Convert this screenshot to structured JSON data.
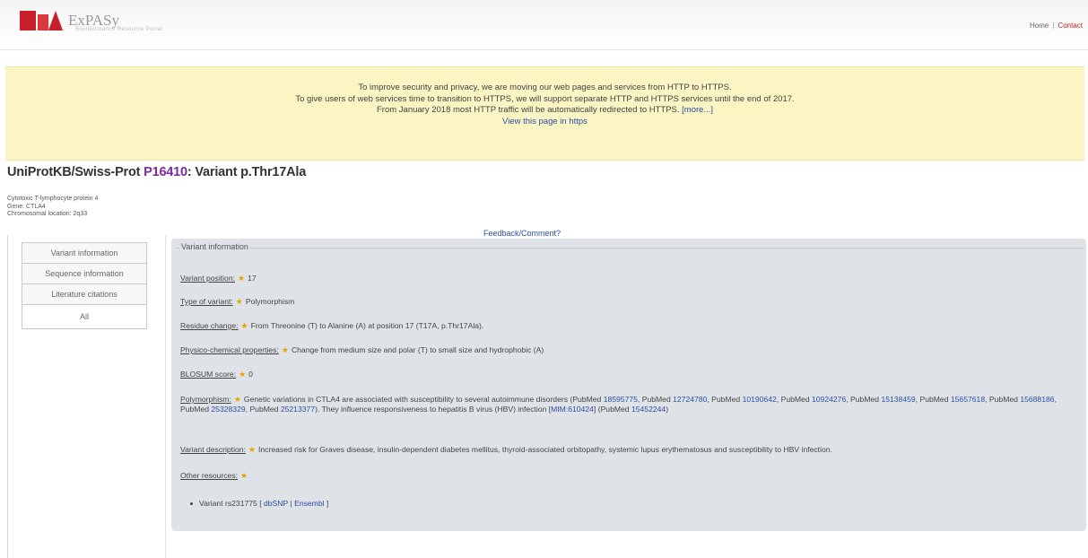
{
  "header": {
    "logo_text": "ExPASy",
    "logo_sub": "Bioinformatics Resource Portal",
    "links": {
      "home": "Home",
      "separator": "|",
      "contact": "Contact"
    }
  },
  "notice": {
    "line1": "To improve security and privacy, we are moving our web pages and services from HTTP to HTTPS.",
    "line2": "To give users of web services time to transition to HTTPS, we will support separate HTTP and HTTPS services until the end of 2017.",
    "line3_text": "From January 2018 most HTTP traffic will be automatically redirected to HTTPS.",
    "more_link": "[more...]",
    "line4": "View this page in https"
  },
  "page": {
    "title_prefix": "UniProtKB/Swiss-Prot",
    "accession": "P16410",
    "title_suffix": ": Variant p.Thr17Ala",
    "protein_name": "Cytotoxic T-lymphocyte protein 4",
    "gene": "Gene: CTLA4",
    "chromosomal_location": "Chromosomal location: 2q33",
    "feedback": "Feedback/Comment?"
  },
  "sidenav": {
    "items": [
      "Variant information",
      "Sequence information",
      "Literature citations",
      "All"
    ]
  },
  "variant_info": {
    "legend": "Variant information",
    "position_label": "Variant position:",
    "position_value": "17",
    "type_label": "Type of variant:",
    "type_value": "Polymorphism",
    "residue_label": "Residue change:",
    "residue_value": "From Threonine (T) to Alanine (A) at position 17 (T17A, p.Thr17Ala).",
    "physico_label": "Physico-chemical properties:",
    "physico_value": "Change from medium size and polar (T) to small size and hydrophobic (A)",
    "blosum_label": "BLOSUM score:",
    "blosum_value": "0",
    "poly_label": "Polymorphism:",
    "poly_text_1": "Genetic variations in CTLA4 are associated with susceptibility to several autoimmune disorders (PubMed",
    "pubmed_1": "18595775",
    "pubmed_2": "12724780",
    "pubmed_3": "10190642",
    "pubmed_4": "10924276",
    "pubmed_5": "15138459",
    "pubmed_6": "15657618",
    "pubmed_7": "15688186",
    "pubmed_8": "25328329",
    "pubmed_9": "25213377",
    "poly_text_2": "They influence responsiveness to hepatitis B virus (HBV) infection",
    "mim": "MIM:610424",
    "pubmed_10": "15452244",
    "pubmed_prefix": "PubMed",
    "desc_label": "Variant description:",
    "desc_value": "Increased risk for Graves disease, insulin-dependent diabetes mellitus, thyroid-associated orbitopathy, systemic lupus erythematosus and susceptibility to HBV infection.",
    "other_label": "Other resources:",
    "variant_text": "Variant rs231775",
    "dbsnp": "dbSNP",
    "ensembl": "Ensembl"
  }
}
